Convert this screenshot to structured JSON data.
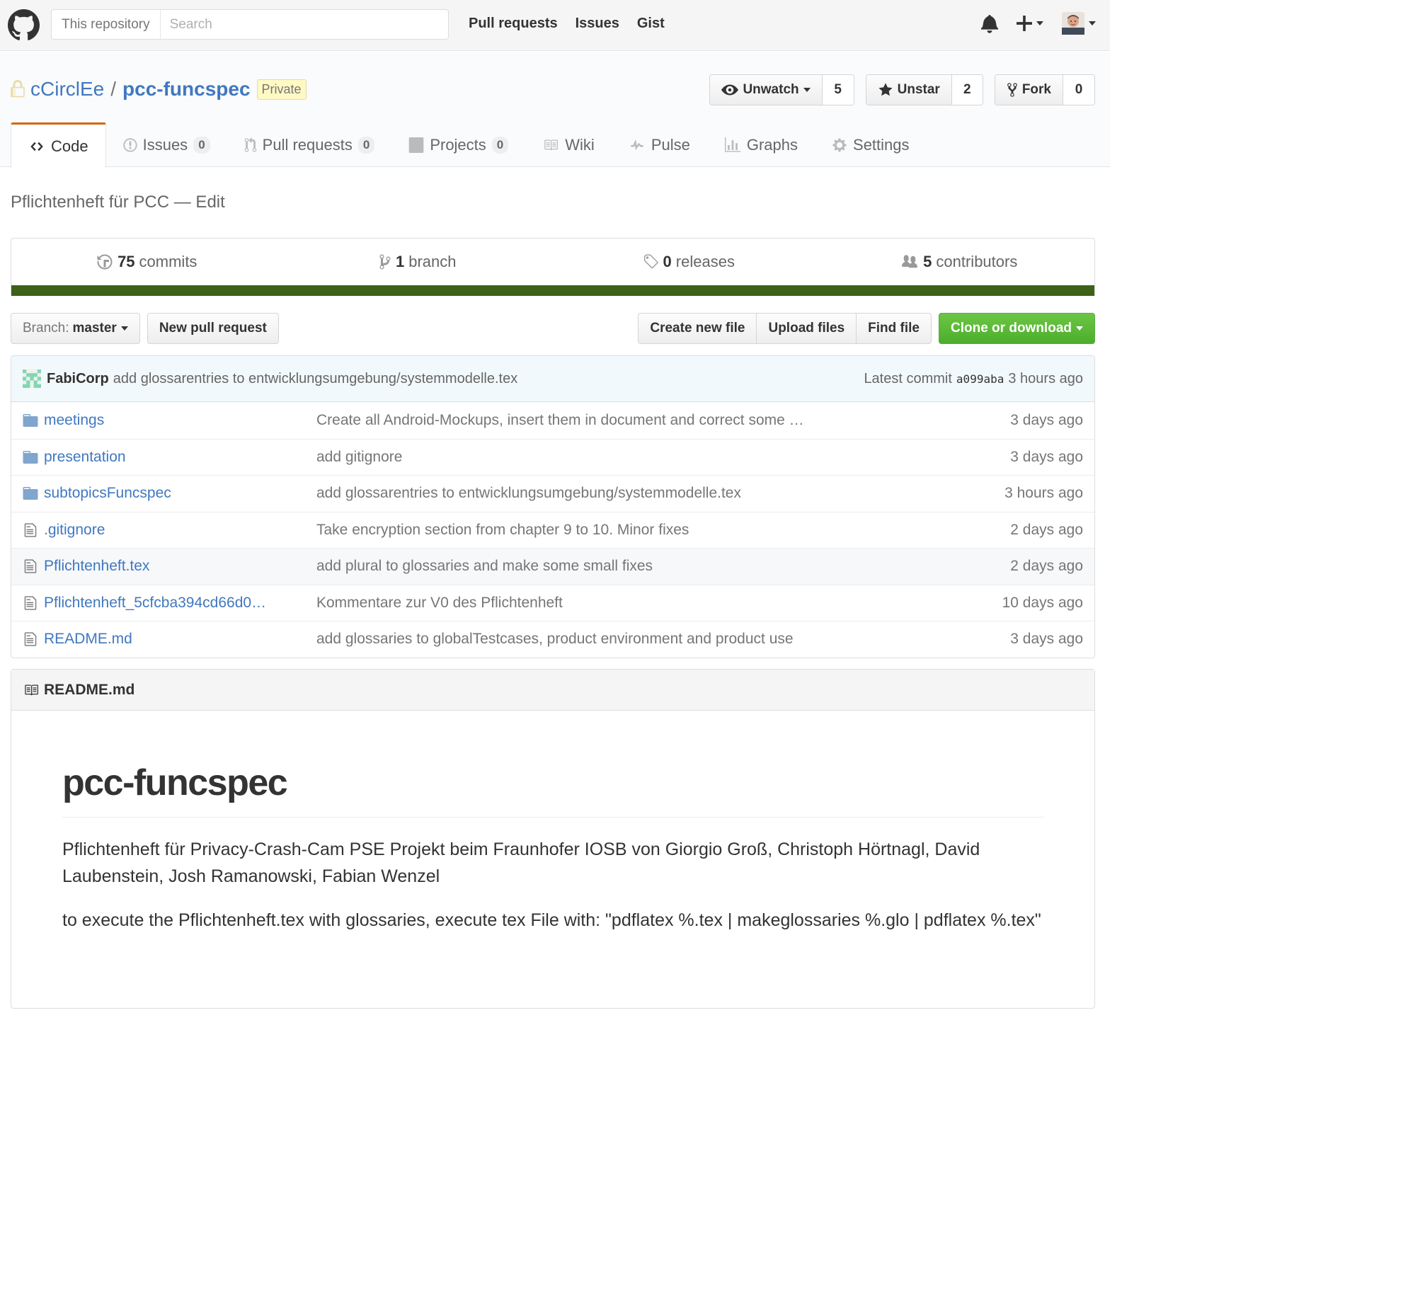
{
  "header": {
    "search_scope": "This repository",
    "search_placeholder": "Search",
    "nav": [
      "Pull requests",
      "Issues",
      "Gist"
    ],
    "icons": [
      "github-logo",
      "bell-icon",
      "plus-icon",
      "avatar"
    ]
  },
  "repo": {
    "owner": "cCirclEe",
    "name": "pcc-funcspec",
    "visibility": "Private",
    "watch": {
      "label": "Unwatch",
      "count": "5"
    },
    "star": {
      "label": "Unstar",
      "count": "2"
    },
    "fork": {
      "label": "Fork",
      "count": "0"
    }
  },
  "tabs": [
    {
      "label": "Code",
      "icon": "code-icon",
      "selected": true
    },
    {
      "label": "Issues",
      "icon": "issue-icon",
      "counter": "0"
    },
    {
      "label": "Pull requests",
      "icon": "pull-request-icon",
      "counter": "0"
    },
    {
      "label": "Projects",
      "icon": "project-icon",
      "counter": "0"
    },
    {
      "label": "Wiki",
      "icon": "book-icon"
    },
    {
      "label": "Pulse",
      "icon": "pulse-icon"
    },
    {
      "label": "Graphs",
      "icon": "graph-icon"
    },
    {
      "label": "Settings",
      "icon": "gear-icon"
    }
  ],
  "description": "Pflichtenheft für PCC — Edit",
  "summary": {
    "commits": {
      "count": "75",
      "label": "commits"
    },
    "branches": {
      "count": "1",
      "label": "branch"
    },
    "releases": {
      "count": "0",
      "label": "releases"
    },
    "contributors": {
      "count": "5",
      "label": "contributors"
    },
    "language_color": "#3d6117"
  },
  "filenav": {
    "branch_label": "Branch:",
    "branch_name": "master",
    "new_pr": "New pull request",
    "create_file": "Create new file",
    "upload_files": "Upload files",
    "find_file": "Find file",
    "clone": "Clone or download"
  },
  "latest_commit": {
    "author": "FabiCorp",
    "message": "add glossarentries to entwicklungsumgebung/systemmodelle.tex",
    "label": "Latest commit",
    "sha": "a099aba",
    "age": "3 hours ago"
  },
  "files": [
    {
      "type": "dir",
      "name": "meetings",
      "message": "Create all Android-Mockups, insert them in document and correct some …",
      "age": "3 days ago"
    },
    {
      "type": "dir",
      "name": "presentation",
      "message": "add gitignore",
      "age": "3 days ago"
    },
    {
      "type": "dir",
      "name": "subtopicsFuncspec",
      "message": "add glossarentries to entwicklungsumgebung/systemmodelle.tex",
      "age": "3 hours ago"
    },
    {
      "type": "file",
      "name": ".gitignore",
      "message": "Take encryption section from chapter 9 to 10. Minor fixes",
      "age": "2 days ago"
    },
    {
      "type": "file",
      "name": "Pflichtenheft.tex",
      "message": "add plural to glossaries and make some small fixes",
      "age": "2 days ago"
    },
    {
      "type": "file",
      "name": "Pflichtenheft_5cfcba394cd66d0…",
      "message": "Kommentare zur V0 des Pflichtenheft",
      "age": "10 days ago"
    },
    {
      "type": "file",
      "name": "README.md",
      "message": "add glossaries to globalTestcases, product environment and product use",
      "age": "3 days ago"
    }
  ],
  "readme": {
    "filename": "README.md",
    "title": "pcc-funcspec",
    "para1": "Pflichtenheft für Privacy-Crash-Cam PSE Projekt beim Fraunhofer IOSB von Giorgio Groß, Christoph Hörtnagl, David Laubenstein, Josh Ramanowski, Fabian Wenzel",
    "para2": "to execute the Pflichtenheft.tex with glossaries, execute tex File with: \"pdflatex %.tex | makeglossaries %.glo | pdflatex %.tex\""
  }
}
